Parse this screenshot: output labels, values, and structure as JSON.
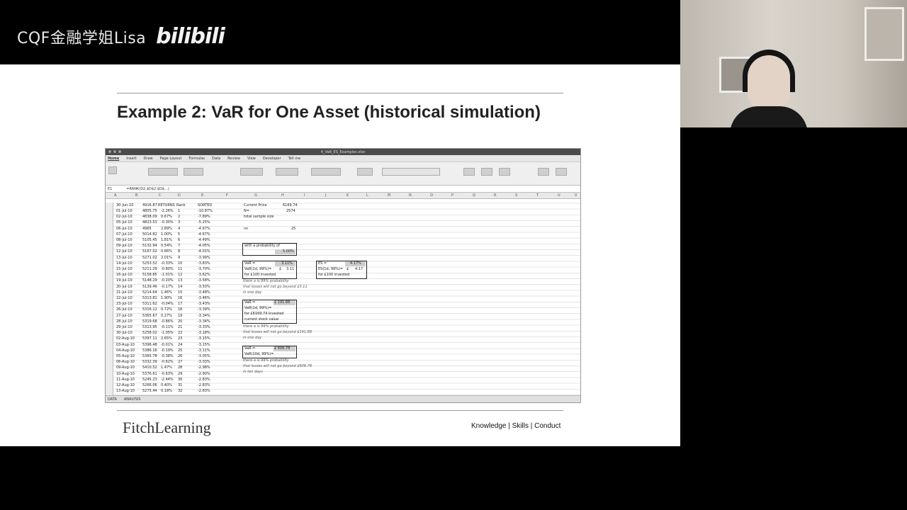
{
  "watermark": {
    "channel": "CQF金融学姐Lisa",
    "logo": "bilibili"
  },
  "slide": {
    "title": "Example 2: VaR for One Asset (historical simulation)",
    "brand": "FitchLearning",
    "tagline": "Knowledge | Skills | Conduct"
  },
  "excel": {
    "window_title": "4_VaR_ES_Examples.xlsx",
    "tabs": [
      "Home",
      "Insert",
      "Draw",
      "Page Layout",
      "Formulas",
      "Data",
      "Review",
      "View",
      "Developer",
      "Tell me"
    ],
    "cell_ref": "E1",
    "formula": "=RANK(D2,$D$2:$D$...)",
    "columns": [
      "A",
      "B",
      "C",
      "D",
      "E",
      "F",
      "G",
      "H",
      "I",
      "J",
      "K",
      "L",
      "M",
      "N",
      "O",
      "P",
      "Q",
      "R",
      "S",
      "T",
      "U",
      "V"
    ],
    "header_row": {
      "date": "30-Jun-10",
      "price": "4916.87",
      "returns": "RETURNS",
      "rank": "Rank",
      "sorted": "SORTED"
    },
    "rows": [
      [
        "01-Jul-10",
        "4805.75",
        "-2.26%",
        "1",
        "-10.87%"
      ],
      [
        "02-Jul-10",
        "4838.09",
        "0.67%",
        "2",
        "-7.89%"
      ],
      [
        "05-Jul-10",
        "4823.53",
        "-0.30%",
        "3",
        "-5.25%"
      ],
      [
        "06-Jul-10",
        "4965",
        "2.89%",
        "4",
        "-4.67%"
      ],
      [
        "07-Jul-10",
        "5014.82",
        "1.00%",
        "5",
        "-4.67%"
      ],
      [
        "08-Jul-10",
        "5105.45",
        "1.81%",
        "6",
        "-4.49%"
      ],
      [
        "09-Jul-10",
        "5132.94",
        "0.54%",
        "7",
        "-4.05%"
      ],
      [
        "12-Jul-10",
        "5167.02",
        "0.66%",
        "8",
        "-4.01%"
      ],
      [
        "13-Jul-10",
        "5271.02",
        "2.01%",
        "9",
        "-3.99%"
      ],
      [
        "14-Jul-10",
        "5253.52",
        "-0.33%",
        "10",
        "-3.83%"
      ],
      [
        "15-Jul-10",
        "5211.29",
        "-0.80%",
        "11",
        "-3.70%"
      ],
      [
        "16-Jul-10",
        "5158.85",
        "-1.01%",
        "12",
        "-3.62%"
      ],
      [
        "19-Jul-10",
        "5148.29",
        "-0.20%",
        "13",
        "-3.58%"
      ],
      [
        "20-Jul-10",
        "5139.46",
        "-0.17%",
        "14",
        "-3.50%"
      ],
      [
        "21-Jul-10",
        "5214.64",
        "1.46%",
        "15",
        "-3.48%"
      ],
      [
        "22-Jul-10",
        "5313.81",
        "1.90%",
        "16",
        "-3.46%"
      ],
      [
        "23-Jul-10",
        "5311.62",
        "-0.04%",
        "17",
        "-3.43%"
      ],
      [
        "26-Jul-10",
        "5316.12",
        "0.72%",
        "18",
        "-3.39%"
      ],
      [
        "27-Jul-10",
        "5365.67",
        "0.27%",
        "19",
        "-3.34%"
      ],
      [
        "28-Jul-10",
        "5319.68",
        "-0.86%",
        "20",
        "-3.34%"
      ],
      [
        "29-Jul-10",
        "5313.95",
        "-0.11%",
        "21",
        "-3.33%"
      ],
      [
        "30-Jul-10",
        "5258.02",
        "-1.05%",
        "22",
        "-3.18%"
      ],
      [
        "02-Aug-10",
        "5397.11",
        "2.65%",
        "23",
        "-3.15%"
      ],
      [
        "03-Aug-10",
        "5396.48",
        "-0.01%",
        "24",
        "-3.15%"
      ],
      [
        "04-Aug-10",
        "5386.16",
        "-0.19%",
        "25",
        "-3.11%"
      ],
      [
        "05-Aug-10",
        "5365.78",
        "-0.38%",
        "26",
        "-3.05%"
      ],
      [
        "06-Aug-10",
        "5332.39",
        "-0.62%",
        "27",
        "-3.03%"
      ],
      [
        "09-Aug-10",
        "5410.52",
        "1.47%",
        "28",
        "-2.98%"
      ],
      [
        "10-Aug-10",
        "5376.61",
        "-0.63%",
        "29",
        "-2.90%"
      ],
      [
        "11-Aug-10",
        "5245.23",
        "-2.44%",
        "30",
        "-2.83%"
      ],
      [
        "12-Aug-10",
        "5266.06",
        "0.40%",
        "31",
        "-2.83%"
      ],
      [
        "13-Aug-10",
        "5275.44",
        "0.18%",
        "32",
        "-2.83%"
      ]
    ],
    "side": {
      "current_price_label": "Current Price",
      "current_price": "6169.74",
      "n_label": "N=",
      "n_value": "2574",
      "total_sample": "total sample size",
      "nn_label": "nn",
      "nn_value": "25",
      "prob_label": "with a probability of",
      "prob_value": "5.00%",
      "var1_label": "VaR =",
      "var1_value": "3.11%",
      "var1_line2": "VaR(1d, 99%)=",
      "var1_currency": "£",
      "var1_amount": "3.11",
      "var1_line3": "for £100 invested",
      "var1_note1": "there a is 99% probability",
      "var1_note2": "that losses will not go beyond £3.11",
      "var1_note3": "in one day",
      "es_label": "ES =",
      "es_value": "4.17%",
      "es_line2": "ES(1d, 99%)=",
      "es_currency": "£",
      "es_amount": "4.17",
      "es_line3": "for £100 invested",
      "var2_label": "VaR =",
      "var2_value": "£ 191.88",
      "var2_line2": "VaR(1d, 99%)=",
      "var2_line3": "for £6169.74 invested",
      "var2_line4": "current stock value",
      "var2_note1": "there a is 99% probability",
      "var2_note2": "that losses will not go beyond £191.88",
      "var2_note3": "in one day",
      "var3_label": "VaR =",
      "var3_value": "£ 606.78",
      "var3_line2": "VaR(10d, 99%)=",
      "var3_note1": "there a is 99% probability",
      "var3_note2": "that losses will not go beyond £606.78",
      "var3_note3": "in ten days"
    },
    "sheet_tabs": [
      "DATA",
      "ANALYSIS"
    ]
  }
}
